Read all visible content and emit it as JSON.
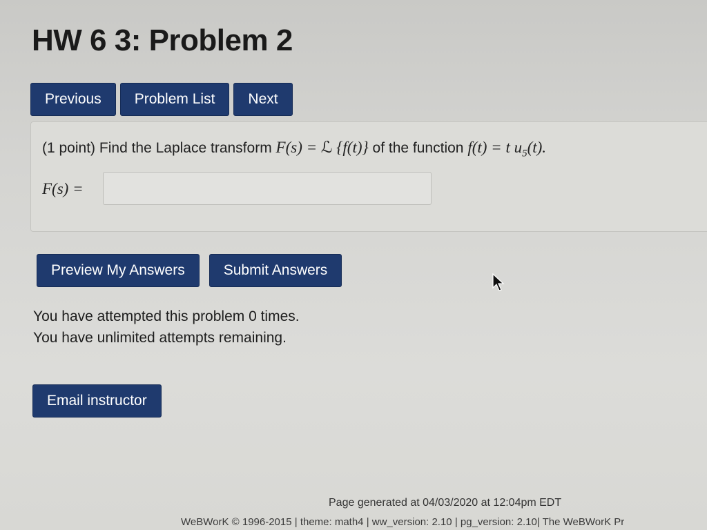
{
  "page": {
    "title": "HW 6 3: Problem 2"
  },
  "nav": {
    "previous": "Previous",
    "problem_list": "Problem List",
    "next": "Next"
  },
  "problem": {
    "points": "(1 point)",
    "text_before": "Find the Laplace transform",
    "lhs": "F(s) = ",
    "laplace_symbol": "ℒ",
    "laplace_arg": "{f(t)}",
    "text_middle": "of the function",
    "function": "f(t) = t u",
    "subscript": "5",
    "function_tail": "(t).",
    "answer_label": "F(s) =",
    "answer_value": ""
  },
  "actions": {
    "preview": "Preview My Answers",
    "submit": "Submit Answers"
  },
  "attempts": {
    "line1": "You have attempted this problem 0 times.",
    "line2": "You have unlimited attempts remaining."
  },
  "email": {
    "label": "Email instructor"
  },
  "footer": {
    "generated": "Page generated at 04/03/2020 at 12:04pm EDT",
    "copyright": "WeBWorK © 1996-2015 | theme: math4 | ww_version: 2.10 | pg_version: 2.10| The WeBWorK Pr"
  },
  "colors": {
    "button": "#1f3a6e",
    "button_text": "#ffffff",
    "background": "#d6d6d3"
  }
}
